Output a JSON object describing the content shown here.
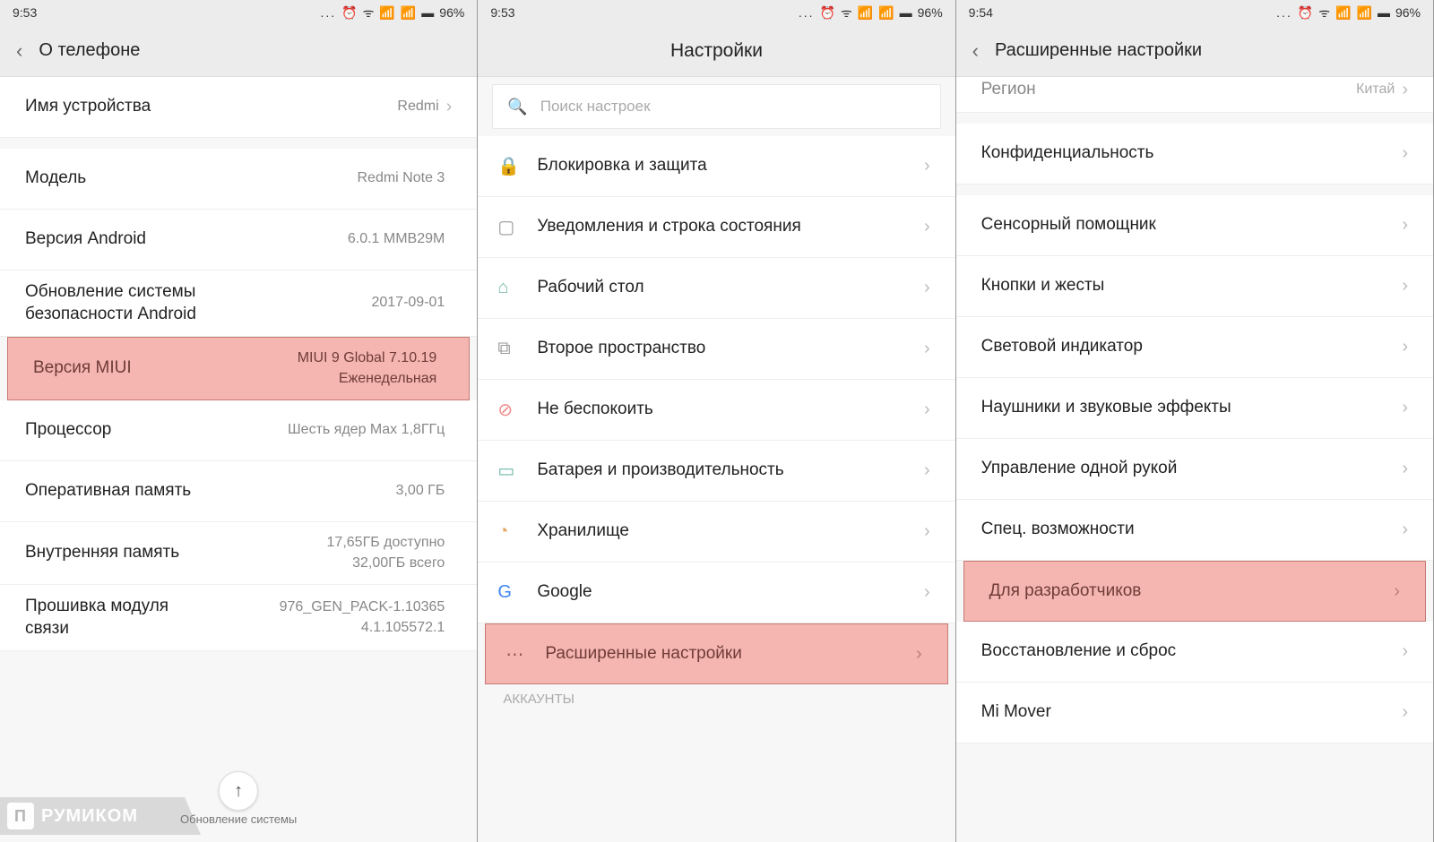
{
  "statusbar": {
    "time1": "9:53",
    "time2": "9:53",
    "time3": "9:54",
    "battery": "96%",
    "dots": "...",
    "icons": "⏰ ᯤ ▮▯▮ ▯▮▮▯"
  },
  "screen1": {
    "title": "О телефоне",
    "rows": {
      "device_name": {
        "label": "Имя устройства",
        "value": "Redmi"
      },
      "model": {
        "label": "Модель",
        "value": "Redmi Note 3"
      },
      "android": {
        "label": "Версия Android",
        "value": "6.0.1 MMB29M"
      },
      "security": {
        "label": "Обновление системы безопасности Android",
        "value": "2017-09-01"
      },
      "miui": {
        "label": "Версия MIUI",
        "value1": "MIUI 9 Global 7.10.19",
        "value2": "Еженедельная"
      },
      "cpu": {
        "label": "Процессор",
        "value": "Шесть ядер Max 1,8ГГц"
      },
      "ram": {
        "label": "Оперативная память",
        "value": "3,00 ГБ"
      },
      "storage": {
        "label": "Внутренняя память",
        "value1": "17,65ГБ доступно",
        "value2": "32,00ГБ всего"
      },
      "baseband": {
        "label": "Прошивка модуля связи",
        "value1": "976_GEN_PACK-1.10365",
        "value2": "4.1.105572.1"
      }
    },
    "float_caption": "Обновление системы",
    "watermark": "РУМИКОМ"
  },
  "screen2": {
    "title": "Настройки",
    "search_placeholder": "Поиск настроек",
    "rows": {
      "lock": {
        "label": "Блокировка и защита"
      },
      "notif": {
        "label": "Уведомления и строка состояния"
      },
      "home": {
        "label": "Рабочий стол"
      },
      "second": {
        "label": "Второе пространство"
      },
      "dnd": {
        "label": "Не беспокоить"
      },
      "battery": {
        "label": "Батарея и производительность"
      },
      "storage": {
        "label": "Хранилище"
      },
      "google": {
        "label": "Google"
      },
      "advanced": {
        "label": "Расширенные настройки"
      }
    },
    "section_accounts": "АККАУНТЫ"
  },
  "screen3": {
    "title": "Расширенные настройки",
    "rows": {
      "region": {
        "label": "Регион",
        "value": "Китай"
      },
      "privacy": {
        "label": "Конфиденциальность"
      },
      "touch": {
        "label": "Сенсорный помощник"
      },
      "buttons": {
        "label": "Кнопки и жесты"
      },
      "led": {
        "label": "Световой индикатор"
      },
      "audio": {
        "label": "Наушники и звуковые эффекты"
      },
      "onehand": {
        "label": "Управление одной рукой"
      },
      "a11y": {
        "label": "Спец. возможности"
      },
      "dev": {
        "label": "Для разработчиков"
      },
      "reset": {
        "label": "Восстановление и сброс"
      },
      "mover": {
        "label": "Mi Mover"
      }
    }
  }
}
